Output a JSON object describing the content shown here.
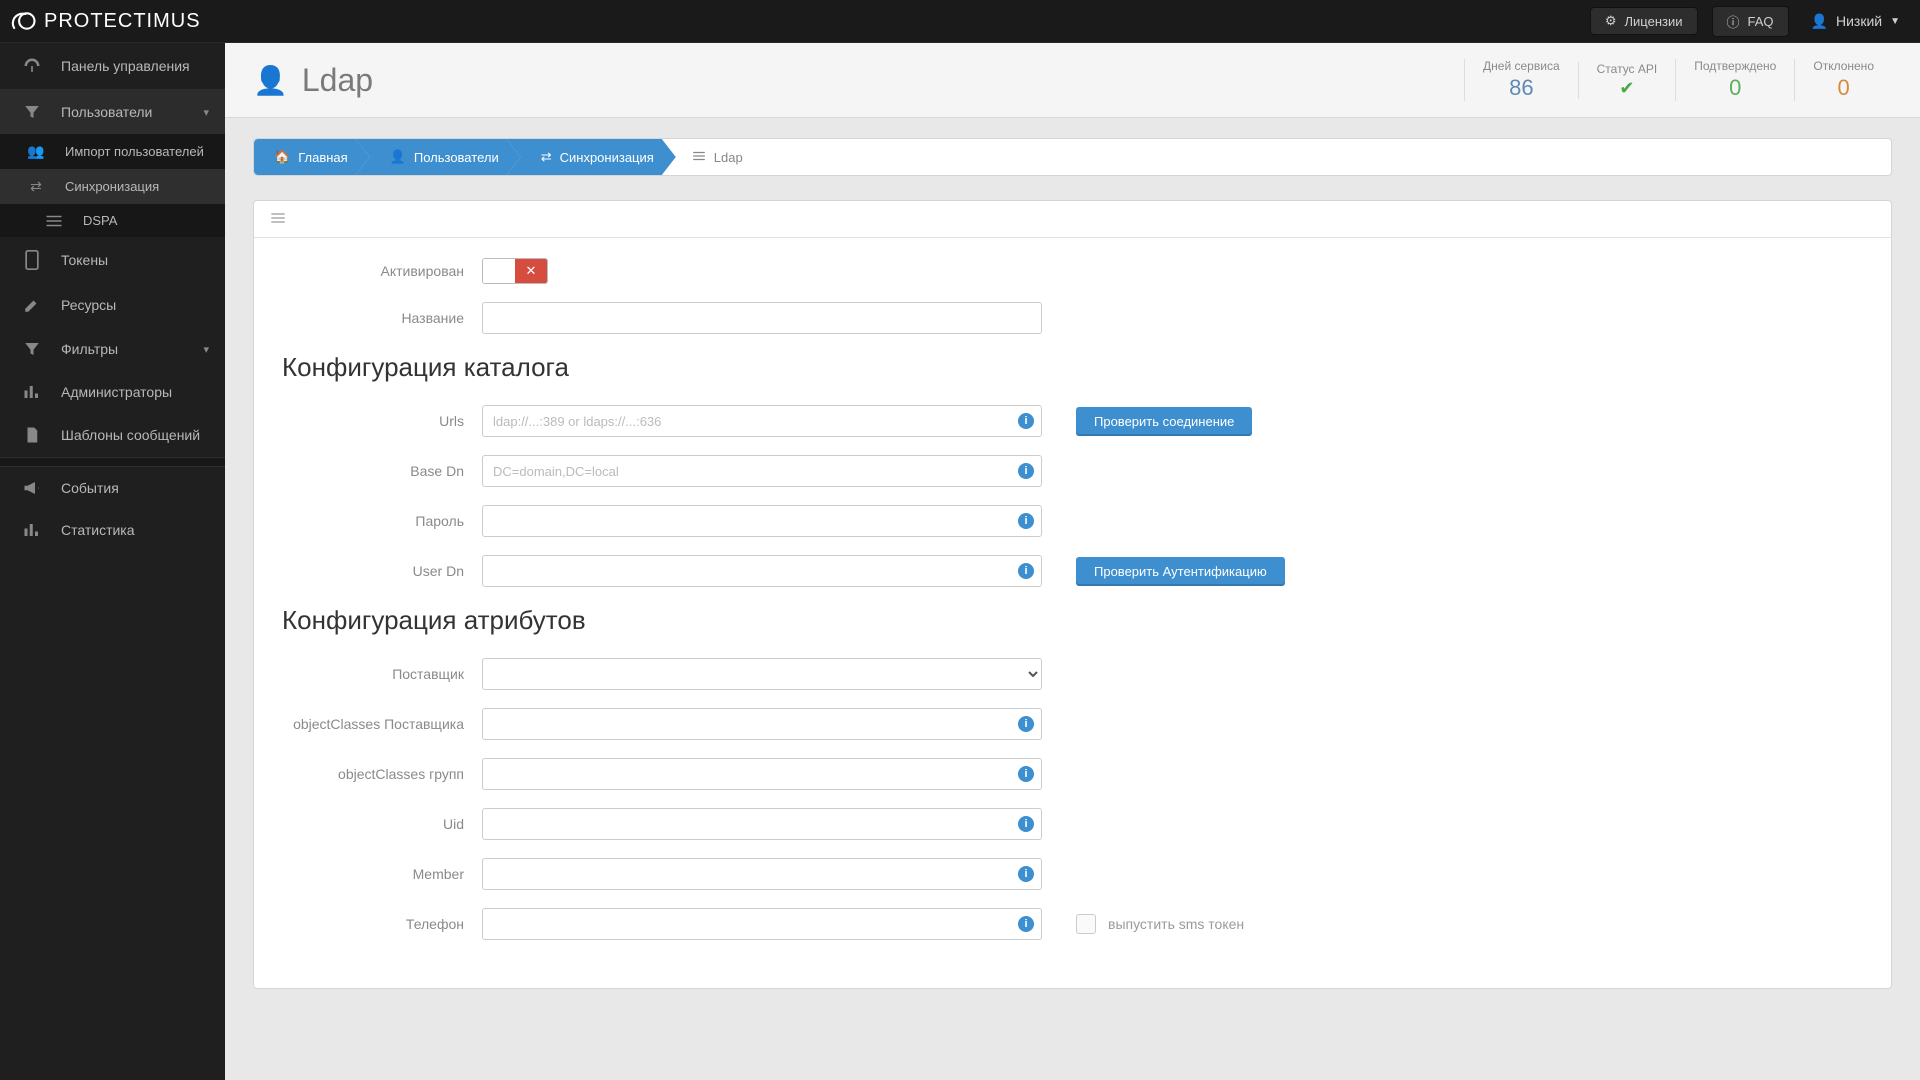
{
  "brand": "PROTECTIMUS",
  "topbar": {
    "licenses": "Лицензии",
    "faq": "FAQ",
    "user": "Низкий"
  },
  "sidebar": {
    "dashboard": "Панель управления",
    "users": "Пользователи",
    "users_sub": {
      "import": "Импорт пользователей",
      "sync": "Синхронизация",
      "dspa": "DSPA"
    },
    "tokens": "Токены",
    "resources": "Ресурсы",
    "filters": "Фильтры",
    "admins": "Администраторы",
    "templates": "Шаблоны сообщений",
    "events": "События",
    "stats": "Статистика"
  },
  "page": {
    "title": "Ldap"
  },
  "stats": {
    "service_days": {
      "label": "Дней сервиса",
      "value": "86"
    },
    "api_status": {
      "label": "Статус API"
    },
    "approved": {
      "label": "Подтверждено",
      "value": "0"
    },
    "rejected": {
      "label": "Отклонено",
      "value": "0"
    }
  },
  "breadcrumb": {
    "home": "Главная",
    "users": "Пользователи",
    "sync": "Синхронизация",
    "ldap": "Ldap"
  },
  "form": {
    "activated": "Активирован",
    "name": "Название",
    "section_catalog": "Конфигурация каталога",
    "urls": "Urls",
    "urls_ph": "ldap://...:389 or ldaps://...:636",
    "base_dn": "Base Dn",
    "base_dn_ph": "DC=domain,DC=local",
    "password": "Пароль",
    "user_dn": "User Dn",
    "btn_test_conn": "Проверить соединение",
    "btn_test_auth": "Проверить Аутентификацию",
    "section_attr": "Конфигурация атрибутов",
    "provider": "Поставщик",
    "obj_provider": "objectClasses Поставщика",
    "obj_groups": "objectClasses групп",
    "uid": "Uid",
    "member": "Member",
    "phone": "Телефон",
    "emit_sms": "выпустить sms токен"
  }
}
